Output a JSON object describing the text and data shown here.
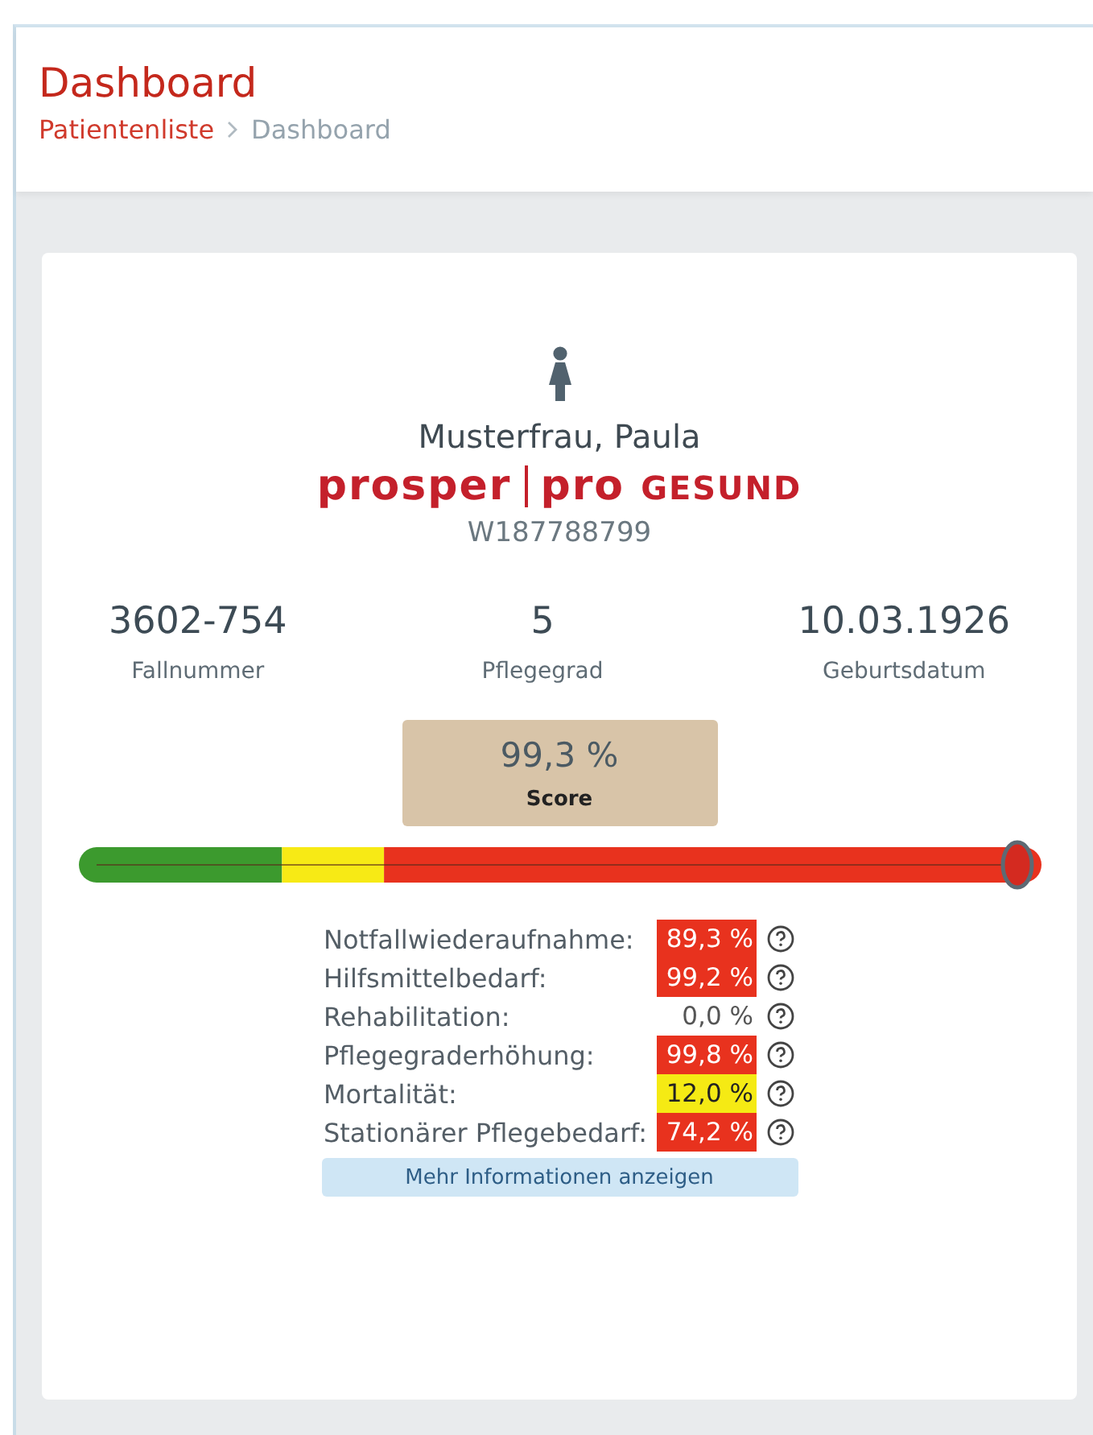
{
  "header": {
    "title": "Dashboard",
    "breadcrumb": [
      {
        "label": "Patientenliste",
        "link": true
      },
      {
        "label": "Dashboard",
        "link": false
      }
    ]
  },
  "patient": {
    "name": "Musterfrau, Paula",
    "insurer": {
      "brand": "prosper",
      "sub_brand": "pro",
      "sub_label": "GESUND"
    },
    "id": "W187788799"
  },
  "facts": [
    {
      "value": "3602-754",
      "label": "Fallnummer"
    },
    {
      "value": "5",
      "label": "Pflegegrad"
    },
    {
      "value": "10.03.1926",
      "label": "Geburtsdatum"
    }
  ],
  "score": {
    "value": "99,3 %",
    "label": "Score"
  },
  "risks": [
    {
      "label": "Notfallwiederaufnahme:",
      "value": "89,3 %",
      "color": "#e8321e"
    },
    {
      "label": "Hilfsmittelbedarf:",
      "value": "99,2 %",
      "color": "#e8321e"
    },
    {
      "label": "Rehabilitation:",
      "value": "0,0 %"
    },
    {
      "label": "Pflegegraderhöhung:",
      "value": "99,8 %",
      "color": "#e8321e"
    },
    {
      "label": "Mortalität:",
      "value": "12,0 %",
      "color": "#f5ea14"
    },
    {
      "label": "Stationärer Pflegebedarf:",
      "value": "74,2 %",
      "color": "#e8321e"
    }
  ],
  "more_button": "Mehr Informationen anzeigen"
}
